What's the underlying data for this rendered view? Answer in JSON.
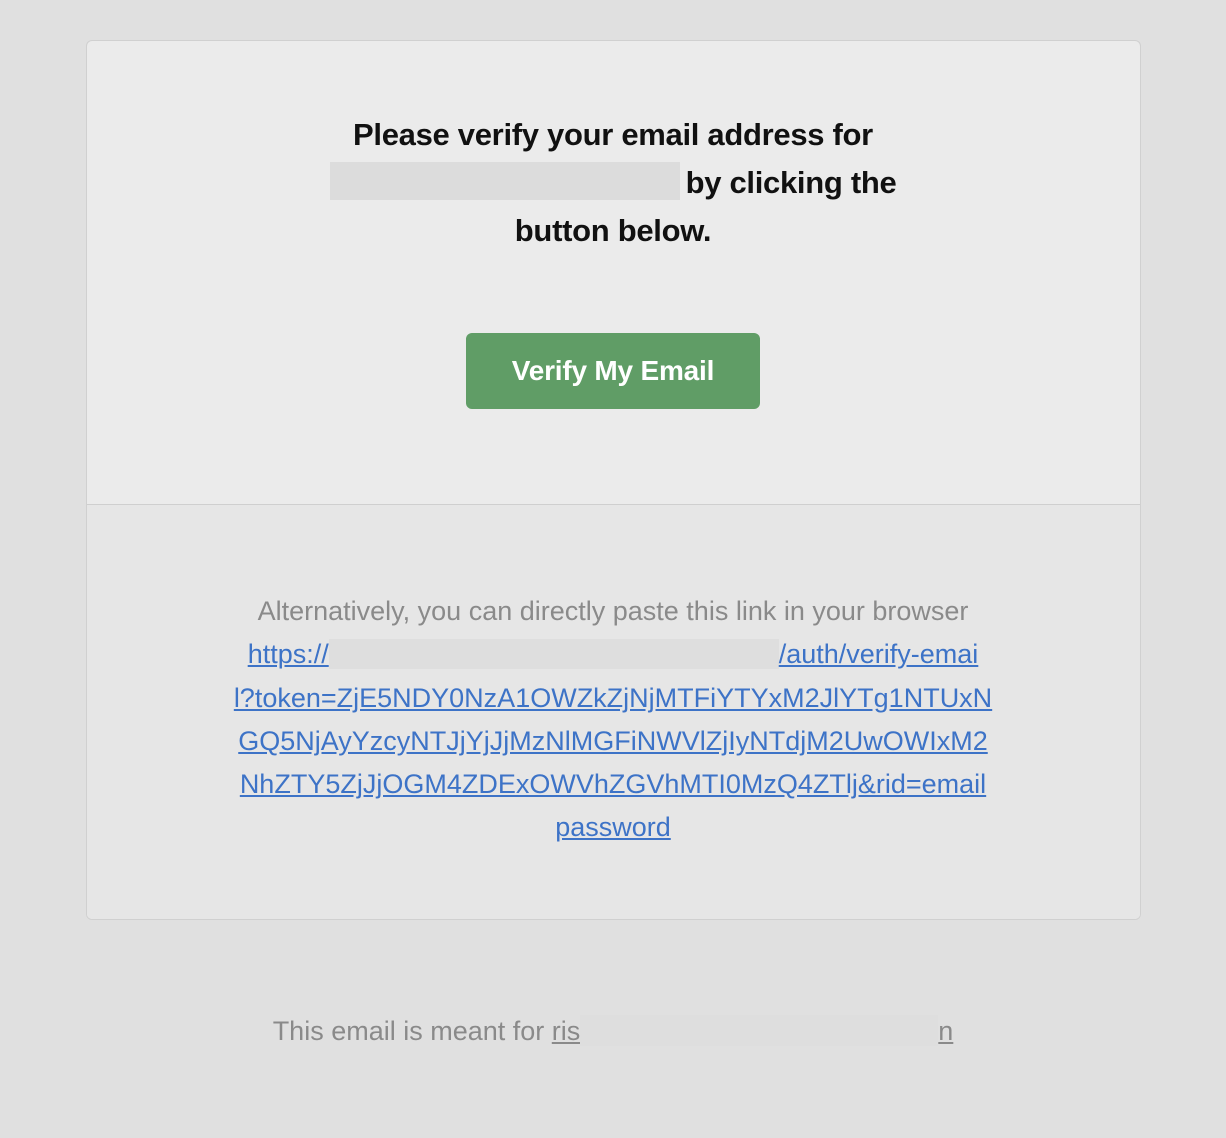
{
  "heading": {
    "line1": "Please verify your email address for",
    "line2_suffix": "by clicking the",
    "line3": "button below."
  },
  "button": {
    "verify_label": "Verify My Email"
  },
  "alternative": {
    "intro": "Alternatively, you can directly paste this link in your browser",
    "link_prefix": "https://",
    "link_part_after_redaction": "/auth/verify-emai",
    "link_line2": "l?token=ZjE5NDY0NzA1OWZkZjNjMTFiYTYxM2JlYTg1NTUxN",
    "link_line3": "GQ5NjAyYzcyNTJjYjJjMzNlMGFiNWVlZjIyNTdjM2UwOWIxM2",
    "link_line4": "NhZTY5ZjJjOGM4ZDExOWVhZGVhMTI0MzQ4ZTlj&rid=email",
    "link_line5": "password"
  },
  "footer": {
    "prefix": "This email is meant for ",
    "name_start": "ris",
    "name_end": "n"
  }
}
